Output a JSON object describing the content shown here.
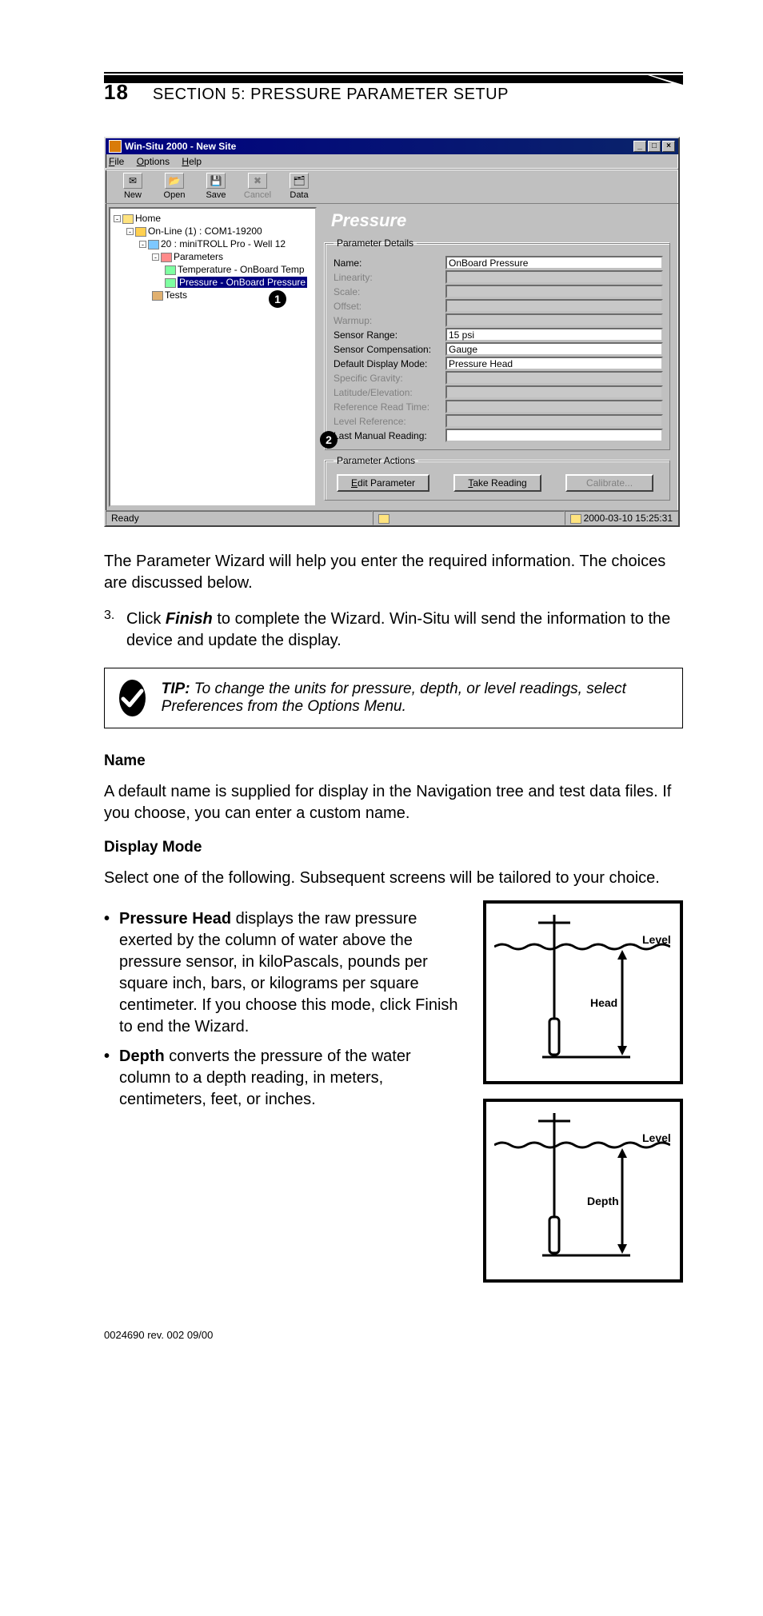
{
  "page_number": "18",
  "section_title": "SECTION 5: PRESSURE PARAMETER SETUP",
  "screenshot": {
    "window_title": "Win-Situ 2000 - New Site",
    "menu": {
      "file": "File",
      "options": "Options",
      "help": "Help"
    },
    "toolbar": {
      "new": "New",
      "open": "Open",
      "save": "Save",
      "cancel": "Cancel",
      "data": "Data"
    },
    "tree": {
      "home": "Home",
      "online": "On-Line (1) : COM1-19200",
      "device": "20 : miniTROLL Pro - Well 12",
      "parameters": "Parameters",
      "temp": "Temperature - OnBoard Temp",
      "pressure": "Pressure - OnBoard Pressure",
      "tests": "Tests"
    },
    "pane_title": "Pressure",
    "details_legend": "Parameter Details",
    "actions_legend": "Parameter Actions",
    "fields": {
      "name_l": "Name:",
      "name_v": "OnBoard Pressure",
      "linearity_l": "Linearity:",
      "linearity_v": "",
      "scale_l": "Scale:",
      "scale_v": "",
      "offset_l": "Offset:",
      "offset_v": "",
      "warmup_l": "Warmup:",
      "warmup_v": "",
      "range_l": "Sensor Range:",
      "range_v": "15 psi",
      "comp_l": "Sensor Compensation:",
      "comp_v": "Gauge",
      "mode_l": "Default Display Mode:",
      "mode_v": "Pressure Head",
      "sg_l": "Specific Gravity:",
      "sg_v": "",
      "lat_l": "Latitude/Elevation:",
      "lat_v": "",
      "reft_l": "Reference Read Time:",
      "reft_v": "",
      "lref_l": "Level Reference:",
      "lref_v": "",
      "last_l": "Last Manual Reading:",
      "last_v": ""
    },
    "buttons": {
      "edit": "Edit Parameter",
      "take": "Take Reading",
      "cal": "Calibrate..."
    },
    "status": {
      "ready": "Ready",
      "ts": "2000-03-10  15:25:31"
    },
    "callouts": {
      "c1": "1",
      "c2": "2"
    }
  },
  "para1": "The Parameter Wizard will help you enter the required information. The choices are discussed below.",
  "step3_n": "3.",
  "step3_a": "Click ",
  "step3_b": "Finish",
  "step3_c": " to complete the Wizard. Win-Situ will send the information to the device and update the display.",
  "tip_label": "TIP:",
  "tip_text": " To change the units for pressure, depth, or level readings, select Preferences from the Options Menu.",
  "h_name": "Name",
  "p_name": "A default name is supplied for display in the Navigation tree and test data files. If you choose, you can enter a custom name.",
  "h_mode": "Display Mode",
  "p_mode": "Select one of the following. Subsequent screens will be tailored to your choice.",
  "b1_a": "Pressure Head",
  "b1_b": " displays the raw pressure exerted by the column of water above the pressure sensor, in kiloPascals, pounds per square inch, bars, or kilograms per square centimeter. If you choose this mode, click Finish to end the Wizard.",
  "b2_a": "Depth",
  "b2_b": " converts the pressure of the water column to a depth reading, in meters, centimeters, feet, or inches.",
  "dia": {
    "level": "Level",
    "head": "Head",
    "depth": "Depth"
  },
  "footer": "0024690  rev.  002    09/00"
}
